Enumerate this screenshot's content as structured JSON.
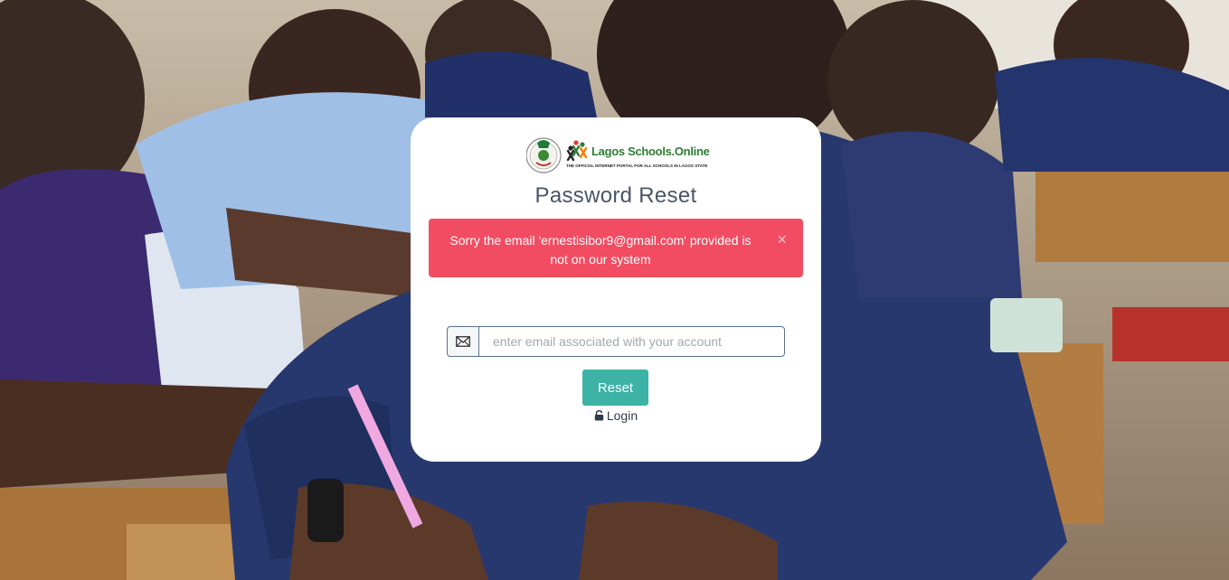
{
  "logo": {
    "brand_name": "Lagos Schools.Online",
    "tagline": "THE OFFICIAL INTERNET PORTAL FOR ALL SCHOOLS IN LAGOS STATE"
  },
  "page": {
    "title": "Password Reset"
  },
  "alert": {
    "message": "Sorry the email 'ernestisibor9@gmail.com' provided is not on our system",
    "close_symbol": "×",
    "color": "#f24c62"
  },
  "form": {
    "email_icon": "envelope-icon",
    "email_placeholder": "enter email associated with your account",
    "email_value": "",
    "reset_label": "Reset",
    "reset_color": "#3cb3a5",
    "login_icon": "lock-icon",
    "login_label": "Login"
  }
}
